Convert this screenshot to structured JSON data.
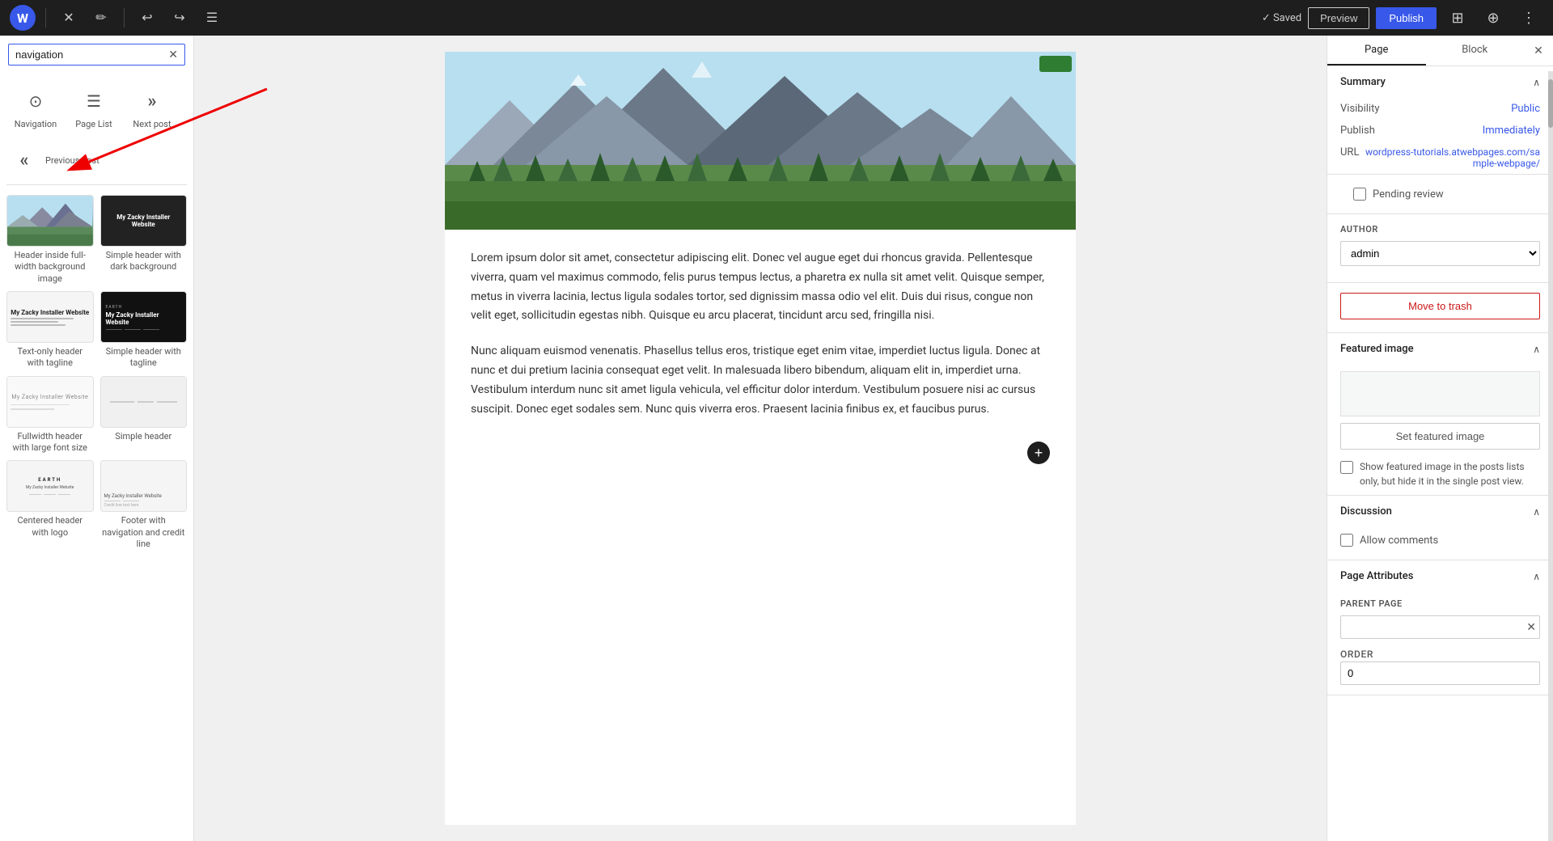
{
  "toolbar": {
    "logo_symbol": "W",
    "close_label": "✕",
    "edit_icon": "✎",
    "undo_icon": "↩",
    "redo_icon": "↪",
    "list_view_icon": "☰",
    "saved_label": "✓ Saved",
    "preview_label": "Preview",
    "publish_label": "Publish",
    "settings_icon": "⊞",
    "tools_icon": "⊕"
  },
  "left_panel": {
    "search_placeholder": "navigation",
    "search_value": "navigation",
    "blocks": [
      {
        "id": "navigation",
        "icon": "⊙",
        "label": "Navigation"
      },
      {
        "id": "page-list",
        "icon": "☰",
        "label": "Page List"
      },
      {
        "id": "next-post",
        "icon": "»",
        "label": "Next post"
      }
    ],
    "previous_post_label": "Previous post",
    "previous_post_icon": "«",
    "patterns": [
      {
        "id": "header-dark",
        "label": "Header inside full-width background image",
        "thumb_type": "mountain_dark"
      },
      {
        "id": "simple-dark",
        "label": "Simple header with dark background",
        "thumb_type": "dark",
        "thumb_text": "My Zacky Installer\nWebsite"
      },
      {
        "id": "text-only",
        "label": "Text-only header with tagline",
        "thumb_type": "text_only",
        "thumb_text": "My Zacky Installer Website"
      },
      {
        "id": "simple-tagline",
        "label": "Simple header with tagline",
        "thumb_type": "dark_tagline",
        "thumb_text": "My Zacky Installer Website"
      },
      {
        "id": "fullwidth-large",
        "label": "Fullwidth header with large font size",
        "thumb_type": "text_large",
        "thumb_text": "My Zacky Installer Website"
      },
      {
        "id": "simple-header",
        "label": "Simple header",
        "thumb_type": "simple",
        "thumb_text": ""
      },
      {
        "id": "centered-logo",
        "label": "Centered header with logo",
        "thumb_type": "centered",
        "thumb_text": "EARTH"
      },
      {
        "id": "footer-nav",
        "label": "Footer with navigation and credit line",
        "thumb_type": "footer",
        "thumb_text": "My Zacky Installer Website"
      }
    ]
  },
  "main_content": {
    "paragraph1": "Lorem ipsum dolor sit amet, consectetur adipiscing elit. Donec vel augue eget dui rhoncus gravida. Pellentesque viverra, quam vel maximus commodo, felis purus tempus lectus, a pharetra ex nulla sit amet velit. Quisque semper, metus in viverra lacinia, lectus ligula sodales tortor, sed dignissim massa odio vel elit. Duis dui risus, congue non velit eget, sollicitudin egestas nibh. Quisque eu arcu placerat, tincidunt arcu sed, fringilla nisi.",
    "paragraph2": "Nunc aliquam euismod venenatis. Phasellus tellus eros, tristique eget enim vitae, imperdiet luctus ligula. Donec at nunc et dui pretium lacinia consequat eget velit. In malesuada libero bibendum, aliquam elit in, imperdiet urna. Vestibulum interdum nunc sit amet ligula vehicula, vel efficitur dolor interdum. Vestibulum posuere nisi ac cursus suscipit. Donec eget sodales sem. Nunc quis viverra eros. Praesent lacinia finibus ex, et faucibus purus.",
    "add_block_icon": "+"
  },
  "right_panel": {
    "tabs": [
      {
        "id": "page",
        "label": "Page"
      },
      {
        "id": "block",
        "label": "Block"
      }
    ],
    "active_tab": "page",
    "close_icon": "✕",
    "summary": {
      "title": "Summary",
      "visibility_label": "Visibility",
      "visibility_value": "Public",
      "publish_label": "Publish",
      "publish_value": "Immediately",
      "url_label": "URL",
      "url_value": "wordpress-tutorials.atwebpages.com/sample-webpage/"
    },
    "pending_review": {
      "label": "Pending review"
    },
    "author_section": {
      "label": "AUTHOR",
      "value": "admin"
    },
    "move_trash_label": "Move to trash",
    "featured_image": {
      "title": "Featured image",
      "set_label": "Set featured image",
      "checkbox_label": "Show featured image in the posts lists only, but hide it in the single post view."
    },
    "discussion": {
      "title": "Discussion",
      "allow_comments_label": "Allow comments"
    },
    "page_attributes": {
      "title": "Page Attributes",
      "parent_page_label": "PARENT PAGE",
      "order_label": "ORDER",
      "order_value": "0"
    }
  }
}
